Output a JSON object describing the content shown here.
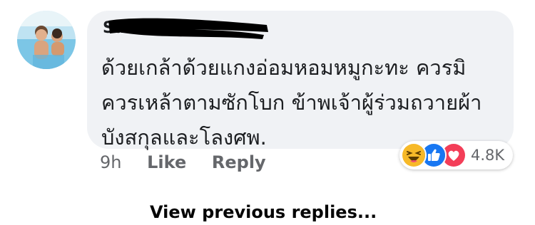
{
  "comment": {
    "author_name": "Su...",
    "text_lines": [
      "ด้วยเกล้าด้วยแกงอ่อมหอมหมูกะทะ ควรมิ",
      "ควรเหล้าตามซักโบก ข้าพเจ้าผู้ร่วมถวายผ้า",
      "บังสกุลและโลงศพ."
    ],
    "reactions": {
      "icons": [
        "haha-icon",
        "like-icon",
        "love-icon"
      ],
      "count": "4.8K"
    }
  },
  "actions": {
    "time": "9h",
    "like_label": "Like",
    "reply_label": "Reply"
  },
  "view_previous_replies": "View previous replies...",
  "colors": {
    "bubble": "#f0f2f5",
    "like_blue": "#1877f2",
    "love_red": "#f33e58",
    "haha_yellow": "#f7b928",
    "meta_gray": "#65676b"
  }
}
